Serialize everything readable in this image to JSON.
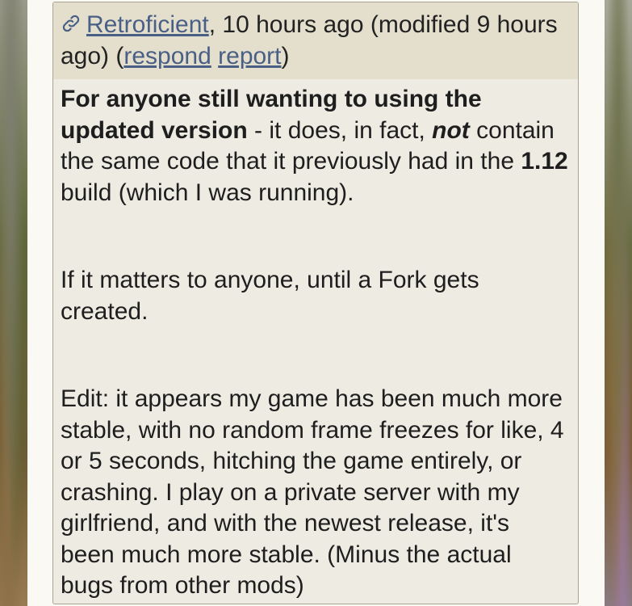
{
  "comment": {
    "author": "Retroficient",
    "meta_time": ", 10 hours ago (modified 9 hours ago) (",
    "respond_label": "respond",
    "report_label": "report",
    "meta_close": ")",
    "body": {
      "p1_bold_lead": "For anyone still wanting to using the updated version",
      "p1_text_a": " - it does, in fact, ",
      "p1_emph": "not",
      "p1_text_b": " contain the same code that it previously had in the ",
      "p1_version": "1.12",
      "p1_text_c": " build (which I was running).",
      "p2": "If it matters to anyone, until a Fork gets created.",
      "p3": "Edit: it appears my game has been much more stable, with no random frame freezes for like, 4 or 5 seconds, hitching the game entirely, or crashing. I play on a private server with my girlfriend, and with the newest release, it's been much more stable. (Minus the actual bugs from other mods)"
    }
  },
  "colors": {
    "link": "#4a5f86",
    "header_bg": "#e3dfcc",
    "body_bg": "#edebe2",
    "page_bg": "#fbf9f3"
  },
  "icons": {
    "permalink": "link-icon"
  }
}
